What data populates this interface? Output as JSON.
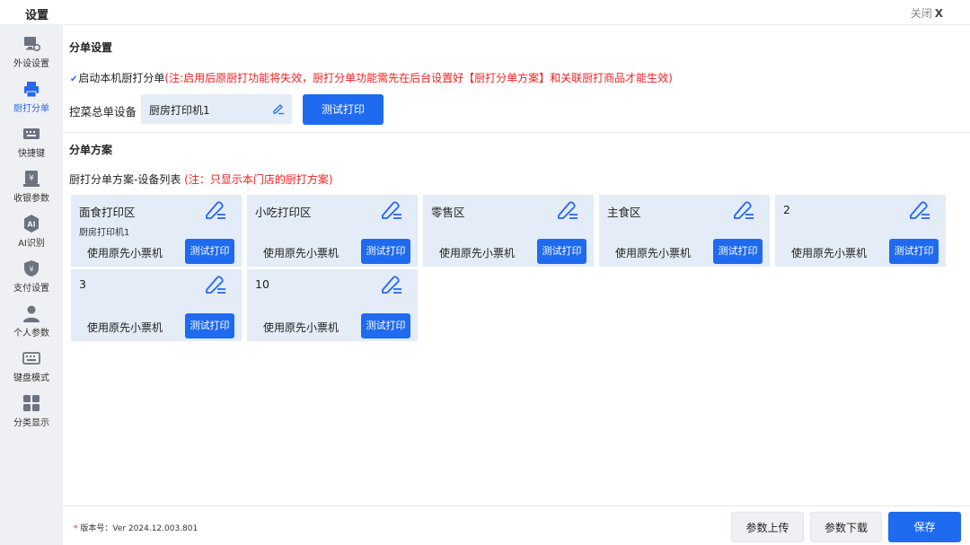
{
  "window": {
    "title": "设置",
    "close_label": "关闭",
    "close_glyph": "X"
  },
  "sidebar": {
    "items": [
      {
        "label": "外设设置",
        "icon": "monitor-gear-icon",
        "active": false
      },
      {
        "label": "厨打分单",
        "icon": "printer-icon",
        "active": true
      },
      {
        "label": "快捷键",
        "icon": "keyboard-icon",
        "active": false
      },
      {
        "label": "收银参数",
        "icon": "cashier-icon",
        "active": false
      },
      {
        "label": "AI识别",
        "icon": "ai-icon",
        "active": false
      },
      {
        "label": "支付设置",
        "icon": "shield-yen-icon",
        "active": false
      },
      {
        "label": "个人参数",
        "icon": "person-icon",
        "active": false
      },
      {
        "label": "键盘模式",
        "icon": "keyboard-mode-icon",
        "active": false
      },
      {
        "label": "分类显示",
        "icon": "grid-icon",
        "active": false
      }
    ]
  },
  "split_settings": {
    "title": "分单设置",
    "enable_label": "启动本机厨打分单",
    "enable_checked": true,
    "enable_warning": "(注:启用后原厨打功能将失效，厨打分单功能需先在后台设置好【厨打分单方案】和关联厨打商品才能生效)",
    "control_label": "控菜总单设备",
    "control_value": "厨房打印机1",
    "test_label": "测试打印"
  },
  "plans": {
    "title": "分单方案",
    "list_caption": "厨打分单方案-设备列表",
    "list_warning": "(注：只显示本门店的厨打方案)",
    "cards": [
      {
        "name": "面食打印区",
        "device": "厨房打印机1",
        "use_label": "使用原先小票机",
        "test_label": "测试打印"
      },
      {
        "name": "小吃打印区",
        "device": "",
        "use_label": "使用原先小票机",
        "test_label": "测试打印"
      },
      {
        "name": "零售区",
        "device": "",
        "use_label": "使用原先小票机",
        "test_label": "测试打印"
      },
      {
        "name": "主食区",
        "device": "",
        "use_label": "使用原先小票机",
        "test_label": "测试打印"
      },
      {
        "name": "2",
        "device": "",
        "use_label": "使用原先小票机",
        "test_label": "测试打印"
      },
      {
        "name": "3",
        "device": "",
        "use_label": "使用原先小票机",
        "test_label": "测试打印"
      },
      {
        "name": "10",
        "device": "",
        "use_label": "使用原先小票机",
        "test_label": "测试打印"
      }
    ]
  },
  "footer": {
    "version_star": "*",
    "version": "版本号：Ver 2024.12.003.801",
    "upload_label": "参数上传",
    "download_label": "参数下载",
    "save_label": "保存"
  },
  "colors": {
    "accent": "#1f6bef",
    "warning": "#ee2222",
    "card_bg": "#e3ecf7",
    "sidebar_bg": "#eef0f3"
  }
}
